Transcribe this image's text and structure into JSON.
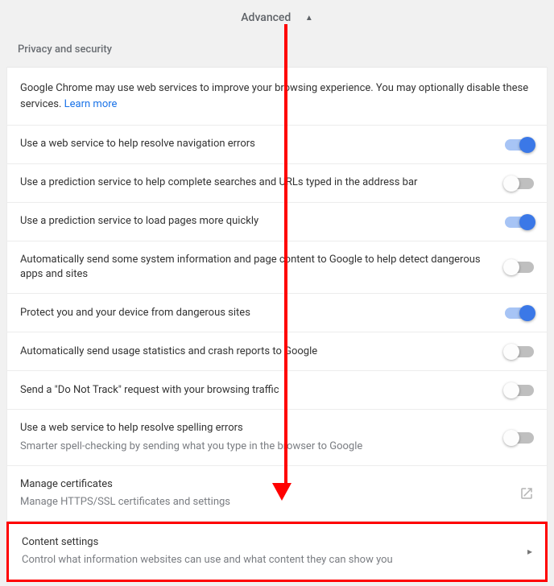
{
  "header": {
    "advanced": "Advanced"
  },
  "section": {
    "title": "Privacy and security"
  },
  "intro": {
    "text": "Google Chrome may use web services to improve your browsing experience. You may optionally disable these services. ",
    "learn_more": "Learn more"
  },
  "rows": [
    {
      "title": "Use a web service to help resolve navigation errors",
      "sub": "",
      "control": "toggle",
      "on": true
    },
    {
      "title": "Use a prediction service to help complete searches and URLs typed in the address bar",
      "sub": "",
      "control": "toggle",
      "on": false
    },
    {
      "title": "Use a prediction service to load pages more quickly",
      "sub": "",
      "control": "toggle",
      "on": true
    },
    {
      "title": "Automatically send some system information and page content to Google to help detect dangerous apps and sites",
      "sub": "",
      "control": "toggle",
      "on": false
    },
    {
      "title": "Protect you and your device from dangerous sites",
      "sub": "",
      "control": "toggle",
      "on": true
    },
    {
      "title": "Automatically send usage statistics and crash reports to Google",
      "sub": "",
      "control": "toggle",
      "on": false
    },
    {
      "title": "Send a \"Do Not Track\" request with your browsing traffic",
      "sub": "",
      "control": "toggle",
      "on": false
    },
    {
      "title": "Use a web service to help resolve spelling errors",
      "sub": "Smarter spell-checking by sending what you type in the browser to Google",
      "control": "toggle",
      "on": false
    },
    {
      "title": "Manage certificates",
      "sub": "Manage HTTPS/SSL certificates and settings",
      "control": "launch"
    }
  ],
  "highlight": {
    "title": "Content settings",
    "sub": "Control what information websites can use and what content they can show you"
  }
}
